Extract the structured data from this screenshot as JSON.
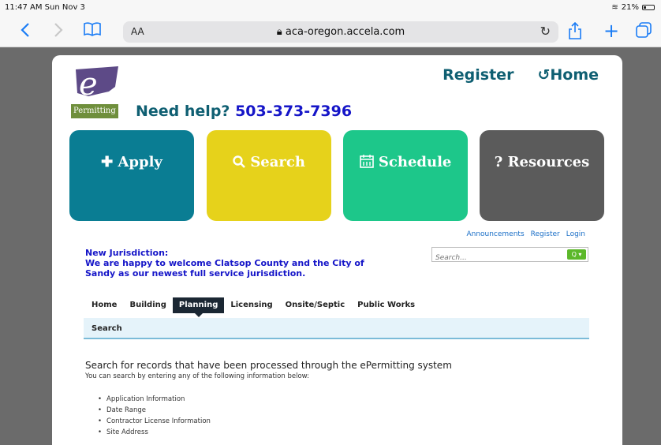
{
  "status_bar": {
    "time": "11:47 AM  Sun Nov 3",
    "signal": "⌔ ⁷",
    "battery": "21%"
  },
  "browser": {
    "text_size": "AA",
    "url": "aca-oregon.accela.com",
    "icons": [
      "chevron-left-icon",
      "chevron-right-icon",
      "bookmarks-icon",
      "reload-icon",
      "share-icon",
      "plus-icon",
      "tabs-icon"
    ]
  },
  "header": {
    "logo_text": "Permitting",
    "help_label": "Need help?",
    "phone": "503-373-7396",
    "register": "Register",
    "home": "Home"
  },
  "tiles": [
    {
      "label": "Apply",
      "icon": "+"
    },
    {
      "label": "Search",
      "icon": "Q"
    },
    {
      "label": "Schedule",
      "icon": "calendar"
    },
    {
      "label": "Resources",
      "icon": "?"
    }
  ],
  "mini_links": [
    "Announcements",
    "Register",
    "Login"
  ],
  "search": {
    "placeholder": "Search..."
  },
  "notice": {
    "title": "New Jurisdiction:",
    "body": "We are happy to welcome Clatsop County and the City of Sandy as our newest full service jurisdiction."
  },
  "nav": {
    "items": [
      "Home",
      "Building",
      "Planning",
      "Licensing",
      "Onsite/Septic",
      "Public Works"
    ],
    "active": "Planning"
  },
  "breadcrumb": "Search",
  "content": {
    "heading": "Search for records that have been processed through the ePermitting system",
    "subheading": "You can search by entering any of the following information below:",
    "bullets": [
      "Application Information",
      "Date Range",
      "Contractor License Information",
      "Site Address"
    ]
  },
  "colors": {
    "apply": "#0a7d93",
    "search": "#e6d21b",
    "schedule": "#1dc78a",
    "resources": "#5b5b5b",
    "link": "#1515c8"
  }
}
